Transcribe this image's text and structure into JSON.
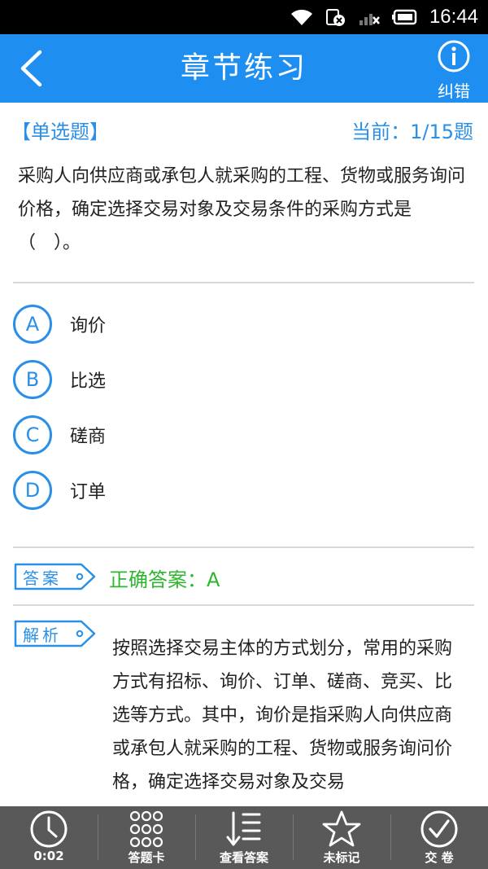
{
  "status_bar": {
    "time": "16:44"
  },
  "header": {
    "title": "章节练习",
    "report_label": "纠错"
  },
  "question": {
    "type_label": "【单选题】",
    "progress": "当前：1/15题",
    "text": "采购人向供应商或承包人就采购的工程、货物或服务询问价格，确定选择交易对象及交易条件的采购方式是（　）。",
    "options": [
      {
        "letter": "A",
        "text": "询价"
      },
      {
        "letter": "B",
        "text": "比选"
      },
      {
        "letter": "C",
        "text": "磋商"
      },
      {
        "letter": "D",
        "text": "订单"
      }
    ]
  },
  "answer": {
    "tag": "答案",
    "text": "正确答案：A"
  },
  "analysis": {
    "tag": "解析",
    "text": "按照选择交易主体的方式划分，常用的采购方式有招标、询价、订单、磋商、竞买、比选等方式。其中，询价是指采购人向供应商或承包人就采购的工程、货物或服务询问价格，确定选择交易对象及交易"
  },
  "bottom_bar": {
    "timer": "0:02",
    "answer_card": "答题卡",
    "view_answer": "查看答案",
    "mark": "未标记",
    "submit": "交 卷"
  }
}
